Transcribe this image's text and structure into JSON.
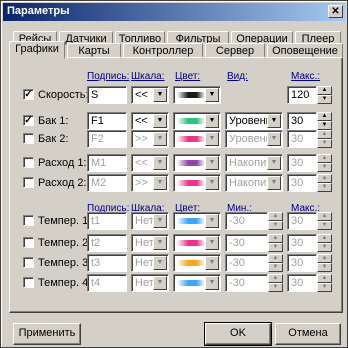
{
  "window": {
    "title": "Параметры"
  },
  "tabs_back": [
    "Рейсы",
    "Датчики",
    "Топливо",
    "Фильтры",
    "Операции",
    "Плеер"
  ],
  "tabs_front": [
    "Графики",
    "Карты",
    "Контроллер",
    "Сервер",
    "Оповещение"
  ],
  "active_tab": "Графики",
  "headers1": {
    "label": "Подпись:",
    "scale": "Шкала:",
    "color": "Цвет:",
    "view": "Вид:",
    "max": "Макс.:"
  },
  "headers2": {
    "label": "Подпись:",
    "scale": "Шкала:",
    "color": "Цвет:",
    "min": "Мин.:",
    "max": "Макс.:"
  },
  "rows": [
    {
      "name": "Скорость:",
      "checked": true,
      "enabled": true,
      "caption": "S",
      "scale": "<<",
      "color": "#1a1a1a",
      "view": "",
      "min": "",
      "max": "120"
    },
    {
      "name": "Бак 1:",
      "checked": true,
      "enabled": true,
      "caption": "F1",
      "scale": "<<",
      "color": "#2ec27e",
      "view": "Уровень",
      "min": "",
      "max": "30"
    },
    {
      "name": "Бак 2:",
      "checked": false,
      "enabled": false,
      "caption": "F2",
      "scale": ">>",
      "color": "#e8358a",
      "view": "Уровень",
      "min": "",
      "max": "30"
    },
    {
      "name": "Расход 1:",
      "checked": false,
      "enabled": false,
      "caption": "M1",
      "scale": "<<",
      "color": "#8e44ad",
      "view": "Накопит.",
      "min": "",
      "max": "30"
    },
    {
      "name": "Расход 2:",
      "checked": false,
      "enabled": false,
      "caption": "M2",
      "scale": ">>",
      "color": "#e8358a",
      "view": "Накопит.",
      "min": "",
      "max": "30"
    },
    {
      "name": "Темпер. 1:",
      "checked": false,
      "enabled": false,
      "caption": "t1",
      "scale": "Нет",
      "color": "#3aa8f0",
      "view": "",
      "min": "-30",
      "max": "30"
    },
    {
      "name": "Темпер. 2:",
      "checked": false,
      "enabled": false,
      "caption": "t2",
      "scale": "Нет",
      "color": "#e8358a",
      "view": "",
      "min": "-30",
      "max": "30"
    },
    {
      "name": "Темпер. 3:",
      "checked": false,
      "enabled": false,
      "caption": "t3",
      "scale": "Нет",
      "color": "#f5a623",
      "view": "",
      "min": "-30",
      "max": "30"
    },
    {
      "name": "Темпер. 4:",
      "checked": false,
      "enabled": false,
      "caption": "t4",
      "scale": "Нет",
      "color": "#3aa8f0",
      "view": "",
      "min": "-30",
      "max": "30"
    }
  ],
  "buttons": {
    "apply": "Применить",
    "ok": "OK",
    "cancel": "Отмена"
  }
}
